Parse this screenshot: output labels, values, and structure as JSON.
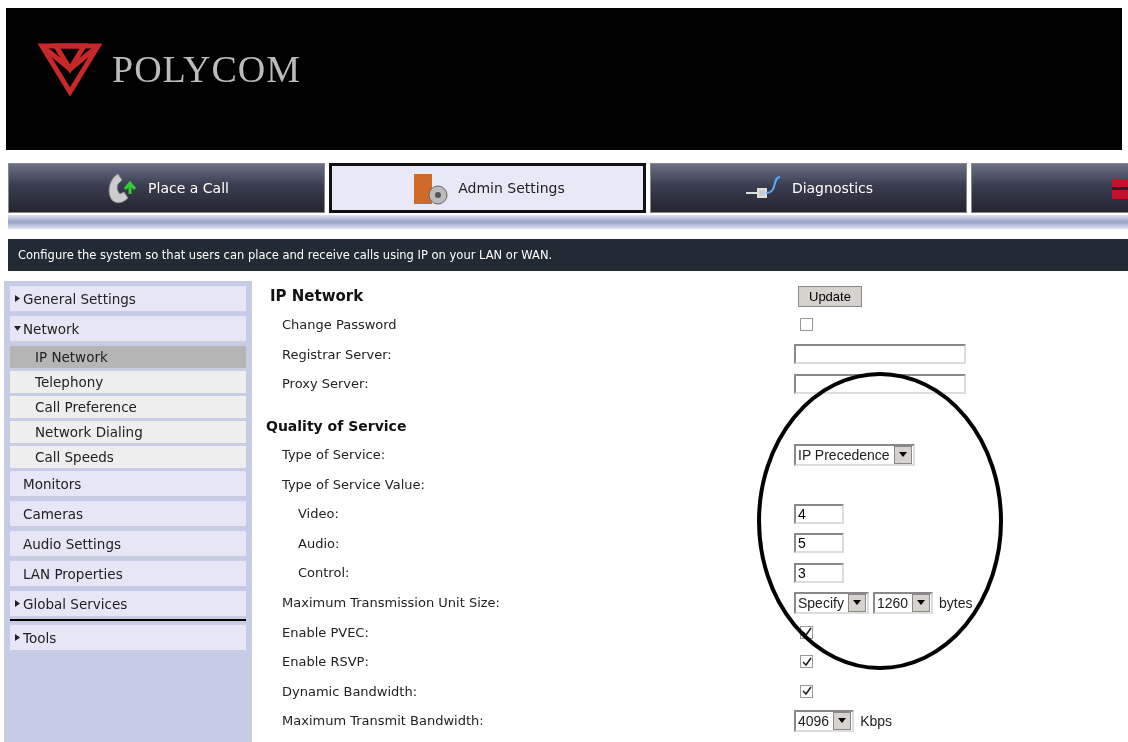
{
  "header": {
    "logo_text": "POLYCOM"
  },
  "tabs": [
    {
      "label": "Place a Call",
      "selected": false
    },
    {
      "label": "Admin Settings",
      "selected": true
    },
    {
      "label": "Diagnostics",
      "selected": false
    },
    {
      "selected": false
    }
  ],
  "info_bar": "Configure the system so that users can place and receive calls using IP on your LAN or WAN.",
  "sidebar": {
    "items": [
      {
        "label": "General Settings",
        "kind": "group",
        "expanded": false,
        "selected": false
      },
      {
        "label": "Network",
        "kind": "group",
        "expanded": true,
        "selected": false,
        "children": [
          {
            "label": "IP Network",
            "selected": true
          },
          {
            "label": "Telephony",
            "selected": false
          },
          {
            "label": "Call Preference",
            "selected": false
          },
          {
            "label": "Network Dialing",
            "selected": false
          },
          {
            "label": "Call Speeds",
            "selected": false
          }
        ]
      },
      {
        "label": "Monitors",
        "kind": "link",
        "selected": false
      },
      {
        "label": "Cameras",
        "kind": "link",
        "selected": false
      },
      {
        "label": "Audio Settings",
        "kind": "link",
        "selected": false
      },
      {
        "label": "LAN Properties",
        "kind": "link",
        "selected": false
      },
      {
        "label": "Global Services",
        "kind": "group",
        "expanded": false,
        "selected": false
      },
      {
        "label": "Tools",
        "kind": "group",
        "expanded": false,
        "selected": false,
        "separated": true
      }
    ]
  },
  "form": {
    "update_button": "Update",
    "sections": [
      {
        "title": "IP Network",
        "rows": [
          {
            "label": "Change Password",
            "kind": "checkbox",
            "checked": false
          },
          {
            "label": "Registrar Server:",
            "kind": "text"
          },
          {
            "label": "Proxy Server:",
            "kind": "text"
          }
        ]
      },
      {
        "title": "Quality of Service",
        "rows": [
          {
            "label": "Type of Service:",
            "kind": "select",
            "selects": [
              "IP Precedence"
            ]
          },
          {
            "label": "Type of Service Value:",
            "kind": "group",
            "children": [
              {
                "label": "Video:",
                "kind": "short",
                "value": "4"
              },
              {
                "label": "Audio:",
                "kind": "short",
                "value": "5"
              },
              {
                "label": "Control:",
                "kind": "short",
                "value": "3"
              }
            ]
          },
          {
            "label": "Maximum Transmission Unit Size:",
            "kind": "select",
            "selects": [
              "Specify",
              "1260"
            ],
            "unit": "bytes"
          },
          {
            "label": "Enable PVEC:",
            "kind": "checkbox",
            "checked": true
          },
          {
            "label": "Enable RSVP:",
            "kind": "checkbox",
            "checked": true
          },
          {
            "label": "Dynamic Bandwidth:",
            "kind": "checkbox",
            "checked": true
          },
          {
            "label": "Maximum Transmit Bandwidth:",
            "kind": "select",
            "selects": [
              "4096"
            ],
            "unit": "Kbps"
          }
        ]
      }
    ]
  }
}
